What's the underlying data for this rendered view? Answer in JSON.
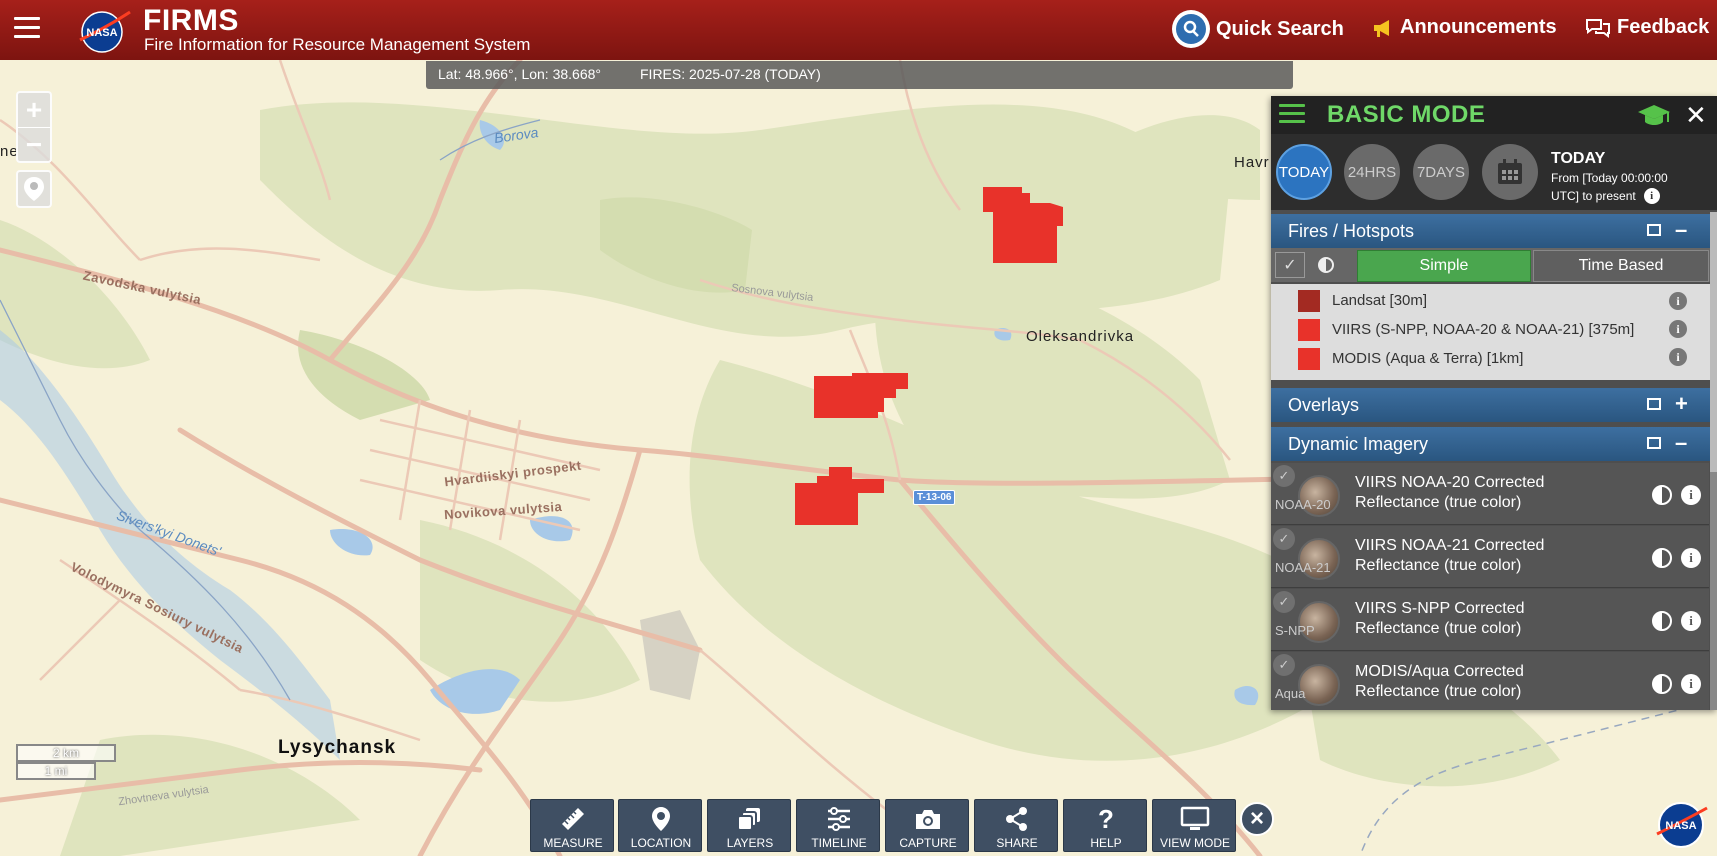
{
  "header": {
    "app_title": "FIRMS",
    "app_subtitle": "Fire Information for Resource Management System",
    "quick_search": "Quick Search",
    "announcements": "Announcements",
    "feedback": "Feedback",
    "nasa_logo_text": "NASA"
  },
  "coord_bar": {
    "latlon": "Lat: 48.966°, Lon: 38.668°",
    "fires": "FIRES: 2025-07-28 (TODAY)"
  },
  "map": {
    "labels": {
      "borova": "Borova",
      "zavodska": "Zavodska vulytsia",
      "sosnova": "Sosnova vulytsia",
      "oleksandrivka": "Oleksandrivka",
      "hvardiiskyi": "Hvardiiskyi prospekt",
      "novikova": "Novikova vulytsia",
      "siverskyi": "Sivers'kyi Donets'",
      "volodymyra": "Volodymyra Sosiury vulytsia",
      "lysychansk": "Lysychansk",
      "zhovtneva": "Zhovtneva vulytsia",
      "havr": "Havr",
      "ne": "ne",
      "top_right": "Oleksandrivka"
    },
    "road_shield": "T-13-06",
    "scale_km": "2 km",
    "scale_mi": "1 mi",
    "zoom_in": "+",
    "zoom_out": "−"
  },
  "panel": {
    "title": "BASIC MODE",
    "time_buttons": [
      "TODAY",
      "24HRS",
      "7DAYS"
    ],
    "time_active": "TODAY",
    "time_info_title": "TODAY",
    "time_info_line1": "From [Today 00:00:00",
    "time_info_line2": "UTC] to present",
    "sections": {
      "fires": "Fires / Hotspots",
      "overlays": "Overlays",
      "dynamic": "Dynamic Imagery"
    },
    "mode_simple": "Simple",
    "mode_time_based": "Time Based",
    "legend": [
      {
        "label": "Landsat [30m]",
        "color": "#a32a22"
      },
      {
        "label": "VIIRS (S-NPP, NOAA-20 & NOAA-21) [375m]",
        "color": "#e8322a"
      },
      {
        "label": "MODIS (Aqua & Terra) [1km]",
        "color": "#e8322a"
      }
    ],
    "imagery": [
      {
        "sat": "NOAA-20",
        "line1": "VIIRS NOAA-20 Corrected",
        "line2": "Reflectance (true color)"
      },
      {
        "sat": "NOAA-21",
        "line1": "VIIRS NOAA-21 Corrected",
        "line2": "Reflectance (true color)"
      },
      {
        "sat": "S-NPP",
        "line1": "VIIRS S-NPP Corrected",
        "line2": "Reflectance (true color)"
      },
      {
        "sat": "Aqua",
        "line1": "MODIS/Aqua Corrected",
        "line2": "Reflectance (true color)"
      }
    ],
    "info_glyph": "i"
  },
  "toolbar": {
    "buttons": [
      "MEASURE",
      "LOCATION",
      "LAYERS",
      "TIMELINE",
      "CAPTURE",
      "SHARE",
      "HELP",
      "VIEW MODE"
    ],
    "help_glyph": "?",
    "close_glyph": "×"
  },
  "colors": {
    "header_red": "#9b1c16",
    "fire_red": "#e8322a",
    "panel_green": "#6fd868",
    "section_blue": "#2f5f8c",
    "toolbar_blue": "#3f4f63"
  }
}
